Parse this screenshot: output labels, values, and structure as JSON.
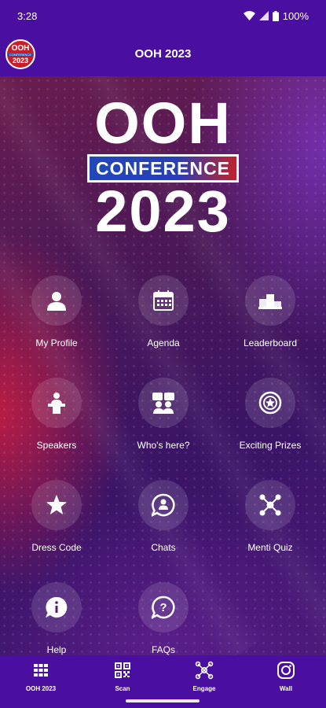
{
  "status_bar": {
    "time": "3:28",
    "battery": "100%"
  },
  "app_bar": {
    "title": "OOH 2023",
    "logo": {
      "line1": "OOH",
      "line2": "CONFERENCE",
      "line3": "2023"
    }
  },
  "hero_logo": {
    "line1": "OOH",
    "line2": "CONFERENCE",
    "line3": "2023"
  },
  "tiles": [
    {
      "label": "My Profile",
      "icon": "person-icon"
    },
    {
      "label": "Agenda",
      "icon": "calendar-icon"
    },
    {
      "label": "Leaderboard",
      "icon": "podium-icon"
    },
    {
      "label": "Speakers",
      "icon": "speaker-podium-icon"
    },
    {
      "label": "Who's here?",
      "icon": "people-icon"
    },
    {
      "label": "Exciting Prizes",
      "icon": "prize-icon"
    },
    {
      "label": "Dress Code",
      "icon": "star-icon"
    },
    {
      "label": "Chats",
      "icon": "chat-icon"
    },
    {
      "label": "Menti Quiz",
      "icon": "network-icon"
    },
    {
      "label": "Help",
      "icon": "info-bubble-icon"
    },
    {
      "label": "FAQs",
      "icon": "question-bubble-icon"
    }
  ],
  "bottom_nav": [
    {
      "label": "OOH 2023",
      "icon": "grid-icon"
    },
    {
      "label": "Scan",
      "icon": "qr-icon"
    },
    {
      "label": "Engage",
      "icon": "network-icon"
    },
    {
      "label": "Wall",
      "icon": "instagram-icon"
    }
  ]
}
